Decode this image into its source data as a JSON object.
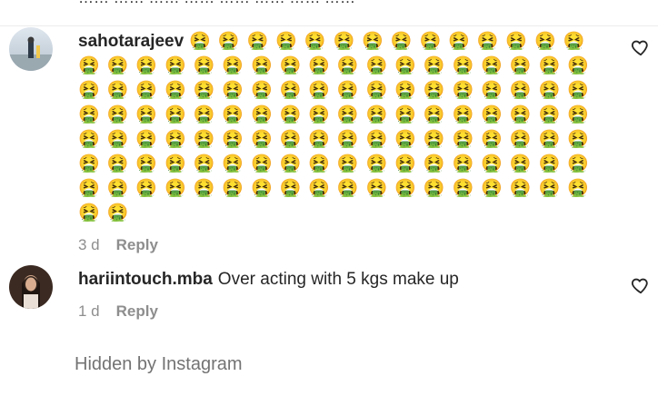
{
  "top_strip": {
    "partial_text": "…… …… …… …… …… …… …… ……"
  },
  "comments": [
    {
      "username": "sahotarajeev",
      "text": "🤮🤮🤮🤮🤮🤮🤮🤮🤮🤮🤮🤮🤮🤮🤮🤮🤮🤮🤮🤮🤮🤮🤮🤮🤮🤮🤮🤮🤮🤮🤮🤮🤮🤮🤮🤮🤮🤮🤮🤮🤮🤮🤮🤮🤮🤮🤮🤮🤮🤮🤮🤮🤮🤮🤮🤮🤮🤮🤮🤮🤮🤮🤮🤮🤮🤮🤮🤮🤮🤮🤮🤮🤮🤮🤮🤮🤮🤮🤮🤮🤮🤮🤮🤮🤮🤮🤮🤮🤮🤮🤮🤮🤮🤮🤮🤮🤮🤮🤮🤮🤮🤮🤮🤮🤮🤮🤮🤮🤮🤮🤮🤮🤮🤮🤮🤮🤮🤮🤮🤮🤮🤮🤮🤮",
      "time": "3 d",
      "reply_label": "Reply"
    },
    {
      "username": "hariintouch.mba",
      "text": "Over acting with 5 kgs make up",
      "time": "1 d",
      "reply_label": "Reply"
    }
  ],
  "hidden_note": "Hidden by Instagram",
  "icons": {
    "like": "heart-outline-icon"
  },
  "colors": {
    "text": "#262626",
    "muted": "#8e8e8e"
  }
}
